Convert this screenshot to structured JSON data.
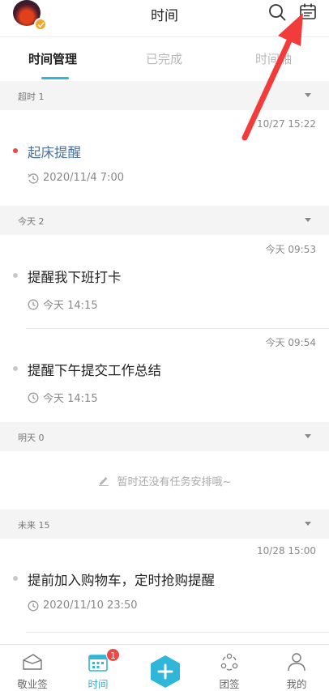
{
  "header": {
    "title": "时间",
    "icons": [
      "search-icon",
      "calendar-icon"
    ]
  },
  "tabs": [
    {
      "label": "时间管理",
      "active": true
    },
    {
      "label": "已完成",
      "active": false
    },
    {
      "label": "时间轴",
      "active": false
    }
  ],
  "sections": [
    {
      "label": "超时 1",
      "items": [
        {
          "stamp": "10/27 15:22",
          "title": "起床提醒",
          "due": "2020/11/4 7:00",
          "status": "overdue"
        }
      ]
    },
    {
      "label": "今天 2",
      "items": [
        {
          "stamp": "今天 09:53",
          "title": "提醒我下班打卡",
          "due": "今天 14:15",
          "status": "normal"
        },
        {
          "stamp": "今天 09:54",
          "title": "提醒下午提交工作总结",
          "due": "今天 14:15",
          "status": "normal"
        }
      ]
    },
    {
      "label": "明天 0",
      "empty_text": "暂时还没有任务安排哦~"
    },
    {
      "label": "未来 15",
      "items": [
        {
          "stamp": "10/28 15:00",
          "title": "提前加入购物车，定时抢购提醒",
          "due": "2020/11/10 23:50",
          "status": "normal"
        }
      ]
    }
  ],
  "bottom_nav": [
    {
      "label": "敬业签",
      "icon": "note-icon",
      "active": false
    },
    {
      "label": "时间",
      "icon": "calendar-icon",
      "active": true,
      "badge": "1"
    },
    {
      "label": "",
      "icon": "plus-icon",
      "active": false
    },
    {
      "label": "团签",
      "icon": "team-icon",
      "active": false
    },
    {
      "label": "我的",
      "icon": "user-icon",
      "active": false
    }
  ],
  "colors": {
    "accent": "#2fb6d8",
    "overdue_title": "#4a6fa0",
    "overdue_dot": "#e84a4a",
    "annotation_arrow": "#f23c3c"
  }
}
